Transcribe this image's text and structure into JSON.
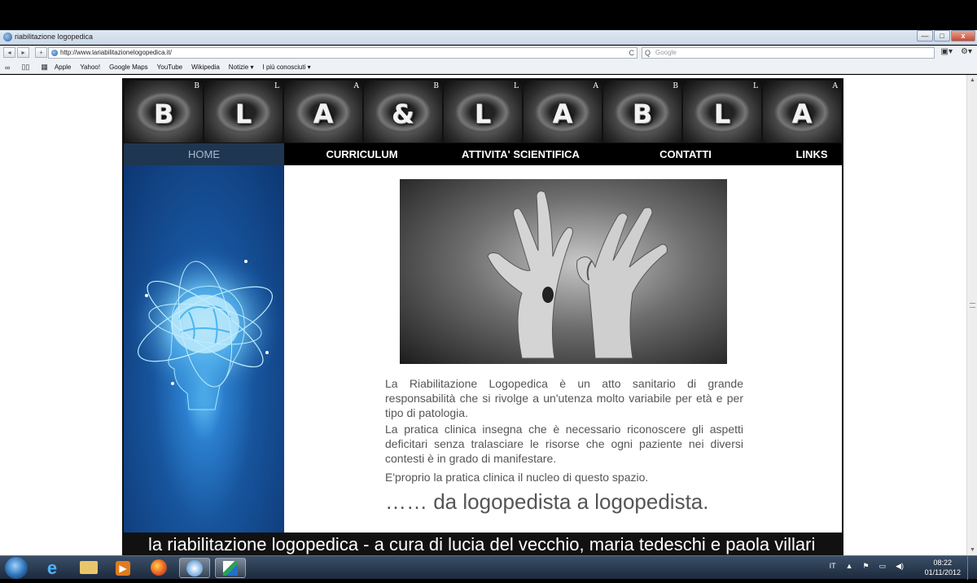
{
  "window": {
    "title": "riabilitazione logopedica",
    "minimize": "—",
    "maximize": "□",
    "close": "x"
  },
  "toolbar": {
    "back": "◂",
    "forward": "▸",
    "add_tab": "+",
    "url": "http://www.lariabilitazionelogopedica.it/",
    "reload": "C",
    "search_placeholder": "Google",
    "search_icon": "Q",
    "page_menu": "▣▾",
    "settings_menu": "⚙▾"
  },
  "bookmarks": {
    "icons": [
      "reader-icon",
      "book-icon",
      "grid-icon"
    ],
    "items": [
      "Apple",
      "Yahoo!",
      "Google Maps",
      "YouTube",
      "Wikipedia",
      "Notizie ▾",
      "I più conosciuti ▾"
    ]
  },
  "banner": {
    "tiles": [
      {
        "letter": "B",
        "small": "B"
      },
      {
        "letter": "L",
        "small": "L"
      },
      {
        "letter": "A",
        "small": "A"
      },
      {
        "letter": "&",
        "small": "B"
      },
      {
        "letter": "L",
        "small": "L"
      },
      {
        "letter": "A",
        "small": "A"
      },
      {
        "letter": "B",
        "small": "B"
      },
      {
        "letter": "L",
        "small": "L"
      },
      {
        "letter": "A",
        "small": "A"
      }
    ]
  },
  "nav": {
    "items": [
      "HOME",
      "CURRICULUM",
      "ATTIVITA' SCIENTIFICA",
      "CONTATTI",
      "LINKS"
    ],
    "active": "HOME"
  },
  "content": {
    "paragraphs": [
      "La Riabilitazione Logopedica è un atto sanitario di grande responsabilità che si rivolge a un'utenza molto variabile per età e per tipo di patologia.",
      "La pratica clinica insegna che è necessario riconoscere gli aspetti deficitari senza tralasciare le risorse che ogni paziente nei diversi contesti è in grado di manifestare.",
      "E'proprio la pratica clinica il nucleo di questo spazio."
    ],
    "closing": "…… da logopedista a logopedista."
  },
  "footer": {
    "text": "la riabilitazione logopedica - a cura di lucia del vecchio, maria tedeschi e paola villari"
  },
  "taskbar": {
    "apps": [
      "start-orb",
      "internet-explorer",
      "file-explorer",
      "media-player",
      "firefox",
      "safari",
      "maps-app"
    ],
    "language": "IT",
    "tray_arrow": "▲",
    "time": "08:22",
    "date": "01/11/2012"
  },
  "scrollbar": {
    "up": "▲",
    "down": "▼"
  }
}
